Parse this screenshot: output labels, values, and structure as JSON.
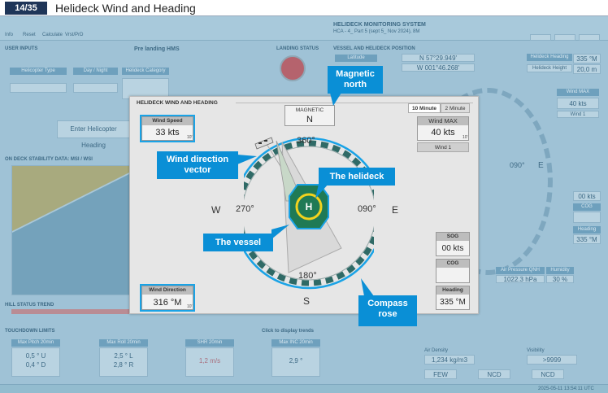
{
  "header": {
    "slide_num": "14/35",
    "title": "Helideck Wind and Heading"
  },
  "background": {
    "toolbar": [
      "Info",
      "Reset",
      "Calculate",
      "Vrst/PrD"
    ],
    "system_title": "HELIDECK MONITORING SYSTEM",
    "system_sub": "HCA - 4_ Part 5 (sept 5_ Nov 2024), 8M",
    "user_inputs": "USER INPUTS",
    "pre_landing": "Pre landing HMS",
    "landing_status": "LANDING STATUS",
    "vessel_pos": "VESSEL AND HELIDECK POSITION",
    "col_helicopter_type": "Helicopter Type",
    "col_day_night": "Day / Night",
    "col_helideck_cat": "Helideck Category",
    "lat_label": "Latitude",
    "lat": "N 57°29.949'",
    "lon": "W 001°46.268'",
    "helideck_heading_label": "Helideck Heading",
    "helideck_heading": "335 °M",
    "helideck_height_label": "Helideck Height",
    "helideck_height": "20,0 m",
    "enter_heading": "Enter Helicopter Heading",
    "on_deck": "ON DECK STABILITY DATA: MSI / WSI",
    "hill_trend": "HILL STATUS TREND",
    "touchdown": "TOUCHDOWN LIMITS",
    "click_trends": "Click to display trends",
    "max_pitch": "Max Pitch 20min",
    "max_roll": "Max Roll 20min",
    "shr": "SHR 20min",
    "max_inc": "Max INC 20min",
    "pitch_vals": [
      "0,5 ° U",
      "0,4 ° D"
    ],
    "roll_vals": [
      "2,5 ° L",
      "2,8 ° R"
    ],
    "shr_val": "1,2 m/s",
    "inc_val": "2,9 °",
    "right_wind_max": "Wind MAX",
    "right_wind_max_val": "40 kts",
    "right_wind1": "Wind 1",
    "right_090": "090°",
    "right_E": "E",
    "right_00kts": "00 kts",
    "right_cog": "COG",
    "right_heading": "Heading",
    "right_heading_val": "335 °M",
    "air_pressure_label": "Air Pressure QNH",
    "air_pressure_val": "1022.3 hPa",
    "humidity_label": "Humidity",
    "humidity_val": "30 %",
    "air_density_label": "Air Density",
    "air_density_val": "1,234 kg/m3",
    "visibility_label": "Visibility",
    "visibility_val": ">9999",
    "cloud_1": "FEW",
    "cloud_2": "NCD",
    "cloud_3": "NCD",
    "footer_time": "2025-05-11 13:54:11 UTC"
  },
  "modal": {
    "title": "HELIDECK WIND AND HEADING",
    "tab_10": "10 Minute",
    "tab_2": "2 Minute",
    "wind_speed_label": "Wind Speed",
    "wind_speed": "33 kts",
    "wind_speed_sub": "10'",
    "wind_max_label": "Wind MAX",
    "wind_max": "40 kts",
    "wind_max_sub": "10'",
    "wind1_btn": "Wind 1",
    "magnetic_label": "MAGNETIC",
    "magnetic_dir": "N",
    "deg_360": "360°",
    "deg_270": "270°",
    "deg_090": "090°",
    "deg_180": "180°",
    "W": "W",
    "E": "E",
    "S": "S",
    "sog_label": "SOG",
    "sog": "00 kts",
    "cog_label": "COG",
    "cog": "",
    "heading_label": "Heading",
    "heading": "335 °M",
    "wind_dir_label": "Wind Direction",
    "wind_dir": "316 °M",
    "wind_dir_sub": "10'",
    "helipad_letter": "H"
  },
  "callouts": {
    "magnetic_north": "Magnetic north",
    "wind_direction_vector": "Wind direction vector",
    "the_helideck": "The helideck",
    "the_vessel": "The vessel",
    "compass_rose": "Compass rose"
  },
  "colors": {
    "accent": "#0a8fd6",
    "selection": "#1aa3e6",
    "helideck_green": "#1f7a55",
    "helideck_yellow": "#f2d21e"
  }
}
